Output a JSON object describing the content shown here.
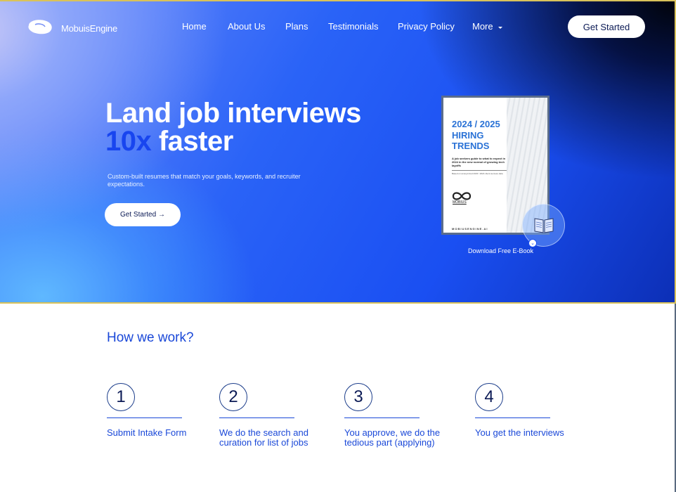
{
  "nav": {
    "brand": "MobuisEngine",
    "links": [
      "Home",
      "About Us",
      "Plans",
      "Testimonials",
      "Privacy Policy",
      "More"
    ],
    "cta": "Get Started",
    "more_icon": "caret-down-icon"
  },
  "hero": {
    "headline_line1": "Land job interviews",
    "headline_accent": "10x",
    "headline_line2_rest": " faster",
    "subtext": "Custom-built resumes that match your goals, keywords, and recruiter expectations.",
    "cta": "Get Started →"
  },
  "ebook": {
    "year": "2024 / 2025",
    "title": "HIRING TRENDS",
    "desc": "A job seekers guide to what to expect in 2024 in the new normal of growing tech layoffs",
    "note": "Based on anonymized 2023 / 2024 client success data",
    "logo_text": "MOBIUS",
    "url": "MOBIUSENGINE.AI",
    "download_label": "Download Free E-Book"
  },
  "how": {
    "title": "How we work?",
    "steps": [
      {
        "num": "1",
        "text": "Submit Intake Form"
      },
      {
        "num": "2",
        "text": "We do the search and\ncuration for list of jobs"
      },
      {
        "num": "3",
        "text": "You approve, we do the\ntedious part (applying)"
      },
      {
        "num": "4",
        "text": "You get the interviews"
      }
    ]
  },
  "colors": {
    "accent": "#1845ef",
    "step_text": "#1a48d8"
  }
}
